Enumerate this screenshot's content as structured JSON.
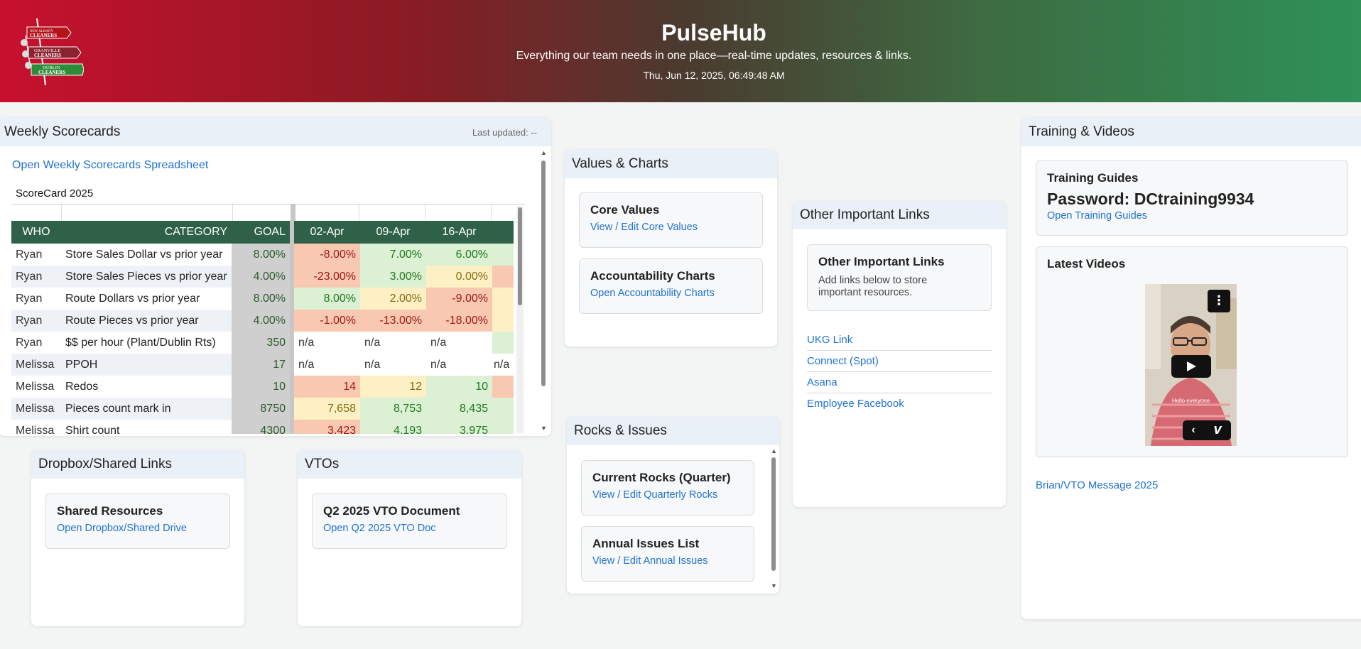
{
  "header": {
    "title": "PulseHub",
    "subtitle": "Everything our team needs in one place—real-time updates, resources & links.",
    "datetime": "Thu, Jun 12, 2025, 06:49:48 AM",
    "logo_lines": [
      "NEW ALBANY CLEANERS",
      "GRANVILLE CLEANERS",
      "DUBLIN CLEANERS"
    ]
  },
  "scorecards": {
    "title": "Weekly Scorecards",
    "last_updated": "Last updated: --",
    "open_link": "Open Weekly Scorecards Spreadsheet",
    "sheet_label": "ScoreCard 2025",
    "columns": [
      "WHO",
      "CATEGORY",
      "GOAL",
      "02-Apr",
      "09-Apr",
      "16-Apr"
    ],
    "rows": [
      {
        "who": "Ryan",
        "category": "Store Sales Dollar vs prior year",
        "goal": "8.00%",
        "w1": "-8.00%",
        "w1c": "red",
        "w2": "7.00%",
        "w2c": "grn",
        "w3": "6.00%",
        "w3c": "grn",
        "w4": "",
        "w4c": "grn"
      },
      {
        "who": "Ryan",
        "category": "Store Sales Pieces vs prior year",
        "goal": "4.00%",
        "w1": "-23.00%",
        "w1c": "red",
        "w2": "3.00%",
        "w2c": "grn",
        "w3": "0.00%",
        "w3c": "yel",
        "w4": "",
        "w4c": "red"
      },
      {
        "who": "Ryan",
        "category": "Route Dollars vs prior year",
        "goal": "8.00%",
        "w1": "8.00%",
        "w1c": "grn",
        "w2": "2.00%",
        "w2c": "yel",
        "w3": "-9.00%",
        "w3c": "red",
        "w4": "",
        "w4c": "yel"
      },
      {
        "who": "Ryan",
        "category": "Route Pieces vs prior year",
        "goal": "4.00%",
        "w1": "-1.00%",
        "w1c": "red",
        "w2": "-13.00%",
        "w2c": "red",
        "w3": "-18.00%",
        "w3c": "red",
        "w4": "",
        "w4c": "yel"
      },
      {
        "who": "Ryan",
        "category": "$$ per hour (Plant/Dublin Rts)",
        "goal": "350",
        "w1": "n/a",
        "w1c": "plain",
        "w2": "n/a",
        "w2c": "plain",
        "w3": "n/a",
        "w3c": "plain",
        "w4": "",
        "w4c": "grn"
      },
      {
        "who": "Melissa",
        "category": "PPOH",
        "goal": "17",
        "w1": "n/a",
        "w1c": "plain",
        "w2": "n/a",
        "w2c": "plain",
        "w3": "n/a",
        "w3c": "plain",
        "w4": "n/a",
        "w4c": "plain"
      },
      {
        "who": "Melissa",
        "category": "Redos",
        "goal": "10",
        "w1": "14",
        "w1c": "red",
        "w2": "12",
        "w2c": "yel",
        "w3": "10",
        "w3c": "grn",
        "w4": "",
        "w4c": "red"
      },
      {
        "who": "Melissa",
        "category": "Pieces count mark in",
        "goal": "8750",
        "w1": "7,658",
        "w1c": "yel",
        "w2": "8,753",
        "w2c": "grn",
        "w3": "8,435",
        "w3c": "grn",
        "w4": "",
        "w4c": "grn"
      },
      {
        "who": "Melissa",
        "category": "Shirt count",
        "goal": "4300",
        "w1": "3,423",
        "w1c": "red",
        "w2": "4,193",
        "w2c": "grn",
        "w3": "3,975",
        "w3c": "grn",
        "w4": "",
        "w4c": "grn"
      }
    ]
  },
  "values_charts": {
    "title": "Values & Charts",
    "core_values": {
      "title": "Core Values",
      "link": "View / Edit Core Values"
    },
    "accountability": {
      "title": "Accountability Charts",
      "link": "Open Accountability Charts"
    }
  },
  "rocks_issues": {
    "title": "Rocks & Issues",
    "rocks": {
      "title": "Current Rocks (Quarter)",
      "link": "View / Edit Quarterly Rocks"
    },
    "issues": {
      "title": "Annual Issues List",
      "link": "View / Edit Annual Issues"
    }
  },
  "other_links": {
    "title": "Other Important Links",
    "card_title": "Other Important Links",
    "card_text": "Add links below to store important resources.",
    "links": [
      "UKG Link",
      "Connect (Spot)",
      "Asana",
      "Employee Facebook"
    ]
  },
  "dropbox": {
    "title": "Dropbox/Shared Links",
    "card_title": "Shared Resources",
    "link": "Open Dropbox/Shared Drive"
  },
  "vtos": {
    "title": "VTOs",
    "card_title": "Q2 2025 VTO Document",
    "link": "Open Q2 2025 VTO Doc"
  },
  "training": {
    "title": "Training & Videos",
    "guides_title": "Training Guides",
    "password": "Password: DCtraining9934",
    "guides_link": "Open Training Guides",
    "videos_title": "Latest Videos",
    "video_caption": "Hello everyone",
    "video_link": "Brian/VTO Message 2025"
  },
  "colors": {
    "header_left": "#c8102e",
    "header_right": "#2e9157",
    "table_header": "#2e6148",
    "link": "#1f72d2",
    "cell_red": "#f8c8b0",
    "cell_yellow": "#fdf0c4",
    "cell_green": "#dcf0d4"
  }
}
